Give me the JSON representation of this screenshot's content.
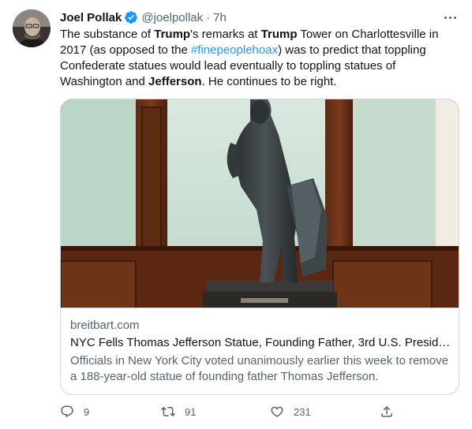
{
  "tweet": {
    "author_name": "Joel Pollak",
    "handle": "@joelpollak",
    "separator": "·",
    "time": "7h",
    "text": {
      "p1": "The substance of ",
      "b1": "Trump",
      "p2": "'s remarks at ",
      "b2": "Trump",
      "p3": " Tower on Charlottesville in 2017 (as opposed to the ",
      "hashtag": "#finepeoplehoax",
      "p4": ") was to predict that toppling Confederate statues would lead eventually to toppling statues of Washington and ",
      "b3": "Jefferson",
      "p5": ". He continues to be right."
    },
    "card": {
      "domain": "breitbart.com",
      "title": "NYC Fells Thomas Jefferson Statue, Founding Father, 3rd U.S. Preside...",
      "description": "Officials in New York City voted unanimously earlier this week to remove a 188-year-old statue of founding father Thomas Jefferson."
    },
    "actions": {
      "replies": "9",
      "retweets": "91",
      "likes": "231"
    }
  },
  "icons": {
    "verified": "verified-badge-icon",
    "more": "more-options-icon",
    "reply": "reply-icon",
    "retweet": "retweet-icon",
    "like": "heart-icon",
    "share": "share-icon"
  },
  "colors": {
    "accent": "#1d9bf0",
    "secondary_text": "#536471",
    "border": "#cfd9de"
  }
}
